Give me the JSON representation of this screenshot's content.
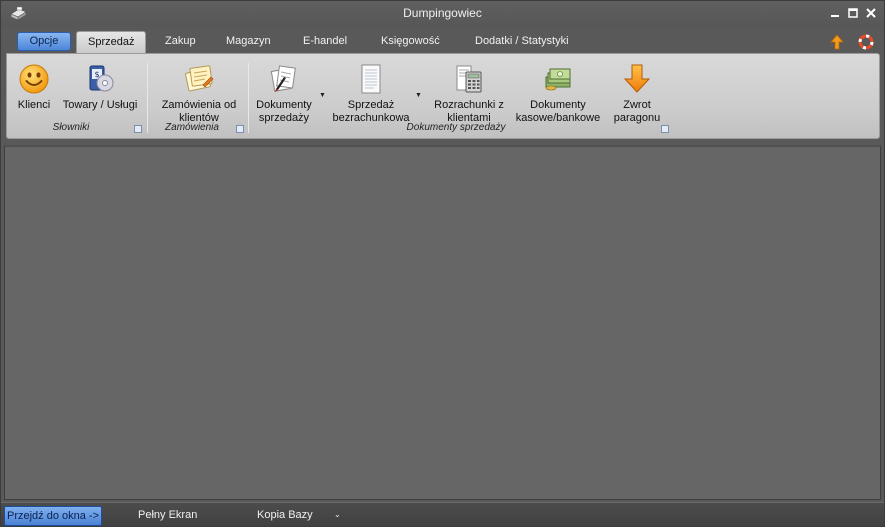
{
  "window": {
    "title": "Dumpingowiec"
  },
  "tabs": {
    "opcje": "Opcje",
    "items": [
      "Sprzedaż",
      "Zakup",
      "Magazyn",
      "E-handel",
      "Księgowość",
      "Dodatki / Statystyki"
    ]
  },
  "ribbon": {
    "buttons": {
      "klienci": "Klienci",
      "towary": "Towary / Usługi",
      "zamowienia": [
        "Zamówienia od",
        "klientów"
      ],
      "dokumenty_sprzedazy": [
        "Dokumenty",
        "sprzedaży"
      ],
      "sprzedaz_bezrachunkowa": [
        "Sprzedaż",
        "bezrachunkowa"
      ],
      "rozrachunki": [
        "Rozrachunki z",
        "klientami"
      ],
      "dokumenty_kasowe": [
        "Dokumenty",
        "kasowe/bankowe"
      ],
      "zwrot": [
        "Zwrot",
        "paragonu"
      ]
    },
    "groups": {
      "slowniki": "Słowniki",
      "zamowienia": "Zamówienia",
      "dokumenty": "Dokumenty sprzedaży"
    }
  },
  "statusbar": {
    "goto_window": "Przejdź do okna ->",
    "full_screen": "Pełny Ekran",
    "backup": "Kopia Bazy"
  },
  "colors": {
    "accent": "#4d86d8",
    "background": "#595959",
    "ribbon": "#cbcbcb"
  },
  "icons": [
    "printer-app-icon",
    "smiley-icon",
    "products-disc-icon",
    "order-notepad-icon",
    "documents-pen-icon",
    "blank-document-icon",
    "calculator-icon",
    "cash-bills-icon",
    "orange-down-arrow-icon",
    "help-ring-icon",
    "up-arrow-icon"
  ]
}
